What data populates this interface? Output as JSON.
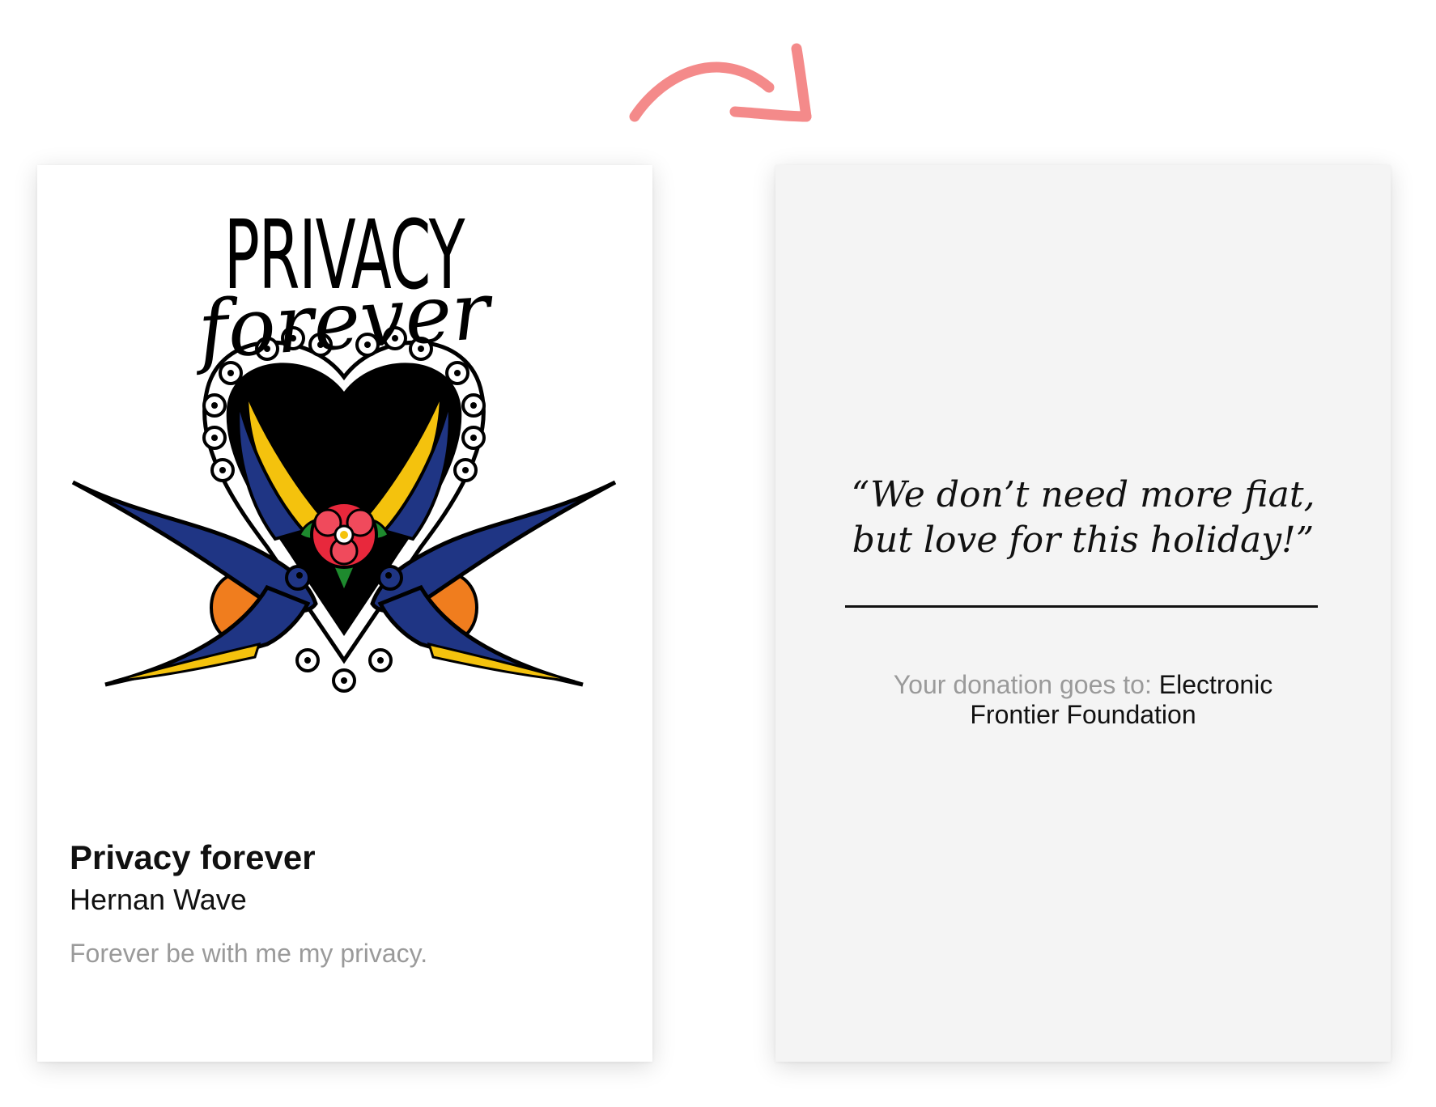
{
  "front": {
    "artwork": {
      "heading": "PRIVACY",
      "script": "forever",
      "icon": "swallows-heart-rose-illustration"
    },
    "title": "Privacy forever",
    "artist": "Hernan Wave",
    "description": "Forever be with me my privacy."
  },
  "back": {
    "quote_line1": "“We don’t need more fiat,",
    "quote_line2": "but love for this holiday!”",
    "donation_label": "Your donation goes to: ",
    "donation_recipient": "Electronic Frontier Foundation"
  },
  "decor": {
    "arrow_icon": "curved-arrow-right-icon",
    "arrow_color": "#f48a8a"
  },
  "colors": {
    "front_bg": "#ffffff",
    "back_bg": "#f4f4f4",
    "muted_text": "#9a9a9a",
    "swallow_blue": "#1f3584",
    "swallow_yellow": "#f4c20d",
    "rose_red": "#e8283c",
    "leaf_green": "#1e8a2e"
  }
}
